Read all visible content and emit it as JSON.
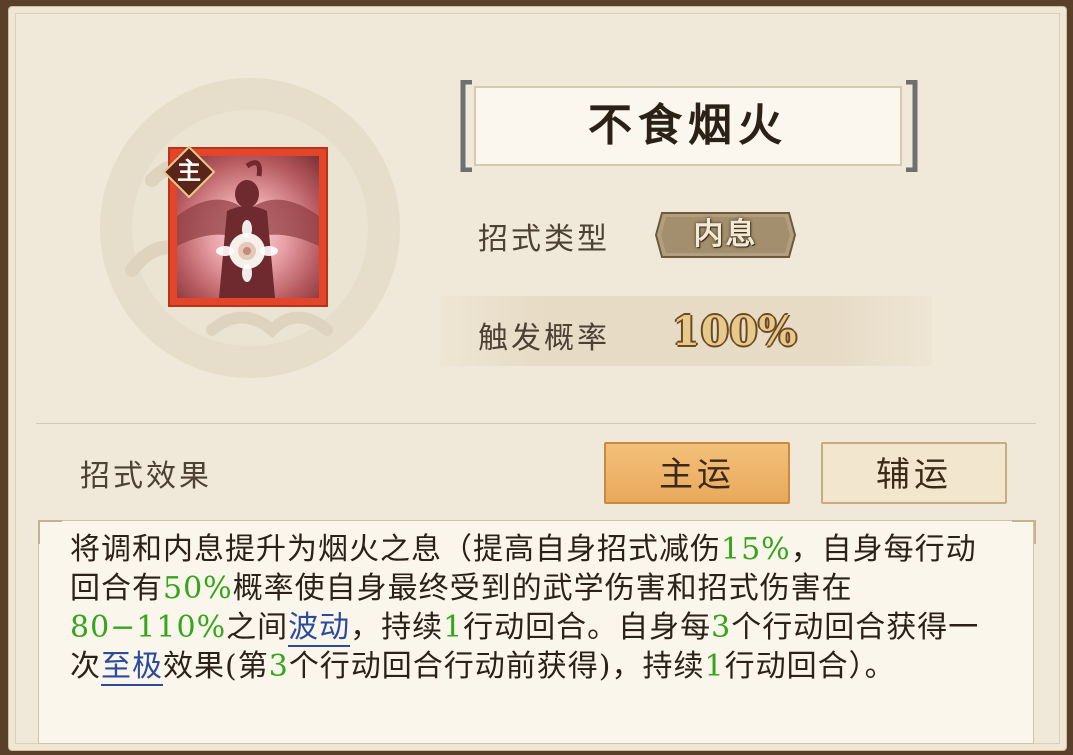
{
  "skill": {
    "name": "不食烟火",
    "badge": "主",
    "type_label": "招式类型",
    "type_value": "内息",
    "rate_label": "触发概率",
    "rate_value": "100%"
  },
  "effect": {
    "label": "招式效果",
    "tab_main": "主运",
    "tab_aux": "辅运",
    "selected_tab": "主运"
  },
  "description": {
    "t1": "将调和内息提升为烟火之息（提高自身招式减伤",
    "v1": "15%",
    "t2": "，自身每行动回合有",
    "v2": "50%",
    "t3": "概率使自身最终受到的武学伤害和招式伤害在",
    "v3": "80−110%",
    "t4": "之间",
    "link1": "波动",
    "t5": "，持续",
    "v4": "1",
    "t6": "行动回合。自身每",
    "v5": "3",
    "t7": "个行动回合获得一次",
    "link2": "至极",
    "t8": "效果(第",
    "v6": "3",
    "t9": "个行动回合行动前获得)，持续",
    "v7": "1",
    "t10": "行动回合）。"
  },
  "colors": {
    "highlight_green": "#35a51b",
    "link_blue": "#2b4b9c",
    "selected_tab": "#eeb46a",
    "panel_bg": "#f0e8d8"
  }
}
